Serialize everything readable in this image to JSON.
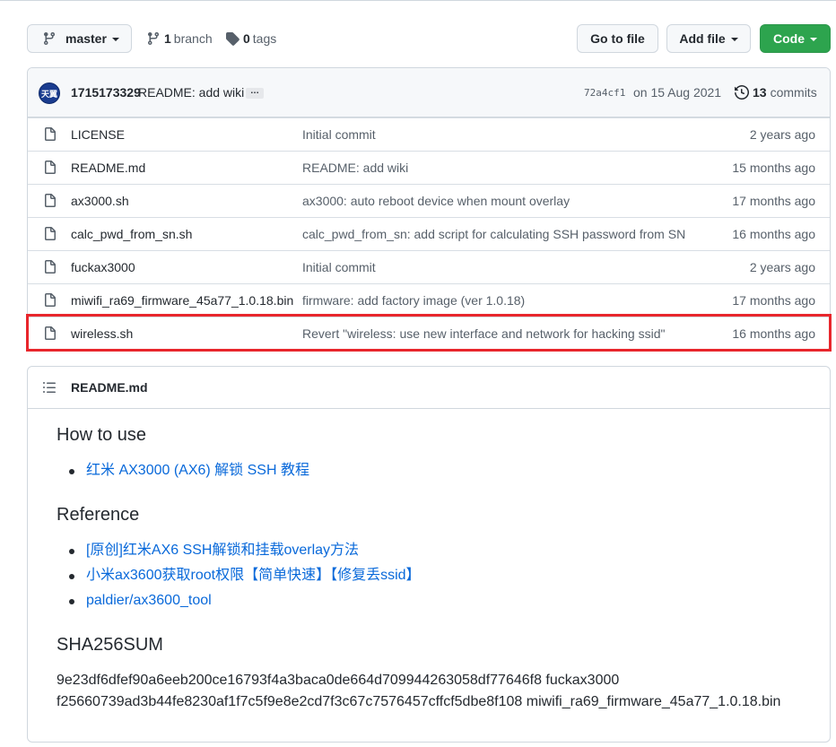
{
  "toolbar": {
    "branch_label": "master",
    "branch_count": "1",
    "branch_word": "branch",
    "tags_count": "0",
    "tags_word": "tags",
    "go_to_file": "Go to file",
    "add_file": "Add file",
    "code": "Code"
  },
  "latest_commit": {
    "author": "1715173329",
    "message": "README: add wiki",
    "ellipsis": "…",
    "sha": "72a4cf1",
    "date": "on 15 Aug 2021",
    "commit_count": "13",
    "commit_word": "commits",
    "avatar_text": "天翼"
  },
  "files": [
    {
      "name": "LICENSE",
      "message": "Initial commit",
      "age": "2 years ago"
    },
    {
      "name": "README.md",
      "message": "README: add wiki",
      "age": "15 months ago"
    },
    {
      "name": "ax3000.sh",
      "message": "ax3000: auto reboot device when mount overlay",
      "age": "17 months ago"
    },
    {
      "name": "calc_pwd_from_sn.sh",
      "message": "calc_pwd_from_sn: add script for calculating SSH password from SN",
      "age": "16 months ago"
    },
    {
      "name": "fuckax3000",
      "message": "Initial commit",
      "age": "2 years ago"
    },
    {
      "name": "miwifi_ra69_firmware_45a77_1.0.18.bin",
      "message": "firmware: add factory image (ver 1.0.18)",
      "age": "17 months ago"
    },
    {
      "name": "wireless.sh",
      "message": "Revert \"wireless: use new interface and network for hacking ssid\"",
      "age": "16 months ago"
    }
  ],
  "highlight_color": "#e8262c",
  "readme": {
    "title": "README.md",
    "how_to_use_heading": "How to use",
    "how_to_use_links": [
      "红米 AX3000 (AX6) 解锁 SSH 教程"
    ],
    "reference_heading": "Reference",
    "reference_links": [
      "[原创]红米AX6 SSH解锁和挂载overlay方法",
      "小米ax3600获取root权限【简单快速】【修复丢ssid】",
      "paldier/ax3600_tool"
    ],
    "sha_heading": "SHA256SUM",
    "sha_lines": [
      "9e23df6dfef90a6eeb200ce16793f4a3baca0de664d709944263058df77646f8 fuckax3000",
      "f25660739ad3b44fe8230af1f7c5f9e8e2cd7f3c67c7576457cffcf5dbe8f108 miwifi_ra69_firmware_45a77_1.0.18.bin"
    ]
  }
}
